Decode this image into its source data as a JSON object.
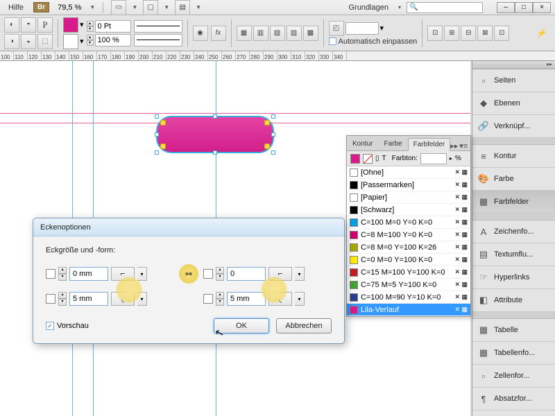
{
  "menubar": {
    "help": "Hilfe",
    "br": "Br",
    "zoom": "79,5 %",
    "workspace": "Grundlagen"
  },
  "controlbar": {
    "stroke_weight": "0 Pt",
    "opacity": "100 %",
    "auto_fit": "Automatisch einpassen"
  },
  "ruler_ticks": [
    "100",
    "110",
    "120",
    "130",
    "140",
    "150",
    "160",
    "170",
    "180",
    "190",
    "200",
    "210",
    "220",
    "230",
    "240",
    "250",
    "260",
    "270",
    "280",
    "290",
    "300",
    "310",
    "320",
    "330",
    "340"
  ],
  "right_dock": {
    "items": [
      {
        "label": "Seiten",
        "icon": "▫"
      },
      {
        "label": "Ebenen",
        "icon": "◆"
      },
      {
        "label": "Verknüpf...",
        "icon": "🔗"
      },
      {
        "label": "Kontur",
        "icon": "≡"
      },
      {
        "label": "Farbe",
        "icon": "🎨"
      },
      {
        "label": "Farbfelder",
        "icon": "▦",
        "active": true
      },
      {
        "label": "Zeichenfo...",
        "icon": "A"
      },
      {
        "label": "Textumflu...",
        "icon": "▤"
      },
      {
        "label": "Hyperlinks",
        "icon": "☞"
      },
      {
        "label": "Attribute",
        "icon": "◧"
      },
      {
        "label": "Tabelle",
        "icon": "▦"
      },
      {
        "label": "Tabellenfo...",
        "icon": "▦"
      },
      {
        "label": "Zellenfor...",
        "icon": "▫"
      },
      {
        "label": "Absatzfor...",
        "icon": "¶"
      }
    ]
  },
  "farbfelder": {
    "tabs": [
      "Kontur",
      "Farbe",
      "Farbfelder"
    ],
    "active_tab": 2,
    "tint_label": "Farbton:",
    "tint_suffix": "%",
    "rows": [
      {
        "name": "[Ohne]",
        "color": "none"
      },
      {
        "name": "[Passermarken]",
        "color": "#000"
      },
      {
        "name": "[Papier]",
        "color": "#fff"
      },
      {
        "name": "[Schwarz]",
        "color": "#000"
      },
      {
        "name": "C=100 M=0 Y=0 K=0",
        "color": "#009fe3"
      },
      {
        "name": "C=8 M=100 Y=0 K=0",
        "color": "#d6006f"
      },
      {
        "name": "C=8 M=0 Y=100 K=26",
        "color": "#a9a800"
      },
      {
        "name": "C=0 M=0 Y=100 K=0",
        "color": "#ffed00"
      },
      {
        "name": "C=15 M=100 Y=100 K=0",
        "color": "#c41e26"
      },
      {
        "name": "C=75 M=5 Y=100 K=0",
        "color": "#3fa535"
      },
      {
        "name": "C=100 M=90 Y=10 K=0",
        "color": "#2a3f8f"
      },
      {
        "name": "Lila-Verlauf",
        "color": "#d81b8b",
        "selected": true
      }
    ]
  },
  "dialog": {
    "title": "Eckenoptionen",
    "section_label": "Eckgröße und -form:",
    "tl": "0 mm",
    "tr": "0",
    "bl": "5 mm",
    "br": "5 mm",
    "preview": "Vorschau",
    "ok": "OK",
    "cancel": "Abbrechen"
  }
}
